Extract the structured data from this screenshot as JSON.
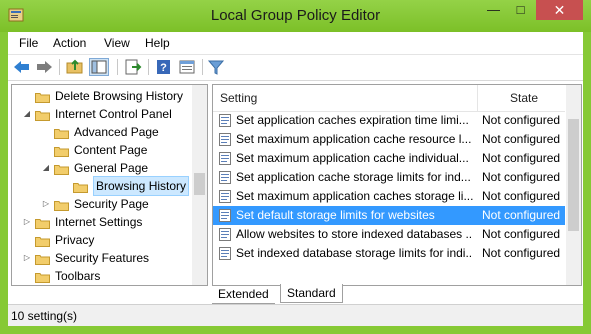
{
  "window": {
    "title": "Local Group Policy Editor"
  },
  "menu": [
    "File",
    "Action",
    "View",
    "Help"
  ],
  "toolbar": {
    "buttons": [
      "back-arrow-icon",
      "forward-arrow-icon",
      "up-folder-icon",
      "show-hide-tree-icon",
      "export-list-icon",
      "help-icon",
      "properties-icon",
      "filter-icon"
    ]
  },
  "tree": {
    "items": [
      {
        "label": "Delete Browsing History",
        "level": 1,
        "twist": ""
      },
      {
        "label": "Internet Control Panel",
        "level": 1,
        "twist": "open"
      },
      {
        "label": "Advanced Page",
        "level": 2,
        "twist": ""
      },
      {
        "label": "Content Page",
        "level": 2,
        "twist": ""
      },
      {
        "label": "General Page",
        "level": 2,
        "twist": "open"
      },
      {
        "label": "Browsing History",
        "level": 3,
        "twist": ""
      },
      {
        "label": "Security Page",
        "level": 2,
        "twist": "closed"
      },
      {
        "label": "Internet Settings",
        "level": 1,
        "twist": "closed"
      },
      {
        "label": "Privacy",
        "level": 1,
        "twist": ""
      },
      {
        "label": "Security Features",
        "level": 1,
        "twist": "closed"
      },
      {
        "label": "Toolbars",
        "level": 1,
        "twist": ""
      }
    ],
    "selected": "Browsing History"
  },
  "list": {
    "columns": {
      "setting": "Setting",
      "state": "State"
    },
    "rows": [
      {
        "setting": "Set application caches expiration time limi...",
        "state": "Not configured"
      },
      {
        "setting": "Set maximum application cache resource l...",
        "state": "Not configured"
      },
      {
        "setting": "Set maximum application cache individual...",
        "state": "Not configured"
      },
      {
        "setting": "Set application cache storage limits for ind...",
        "state": "Not configured"
      },
      {
        "setting": "Set maximum application caches storage li...",
        "state": "Not configured"
      },
      {
        "setting": "Set default storage limits for websites",
        "state": "Not configured"
      },
      {
        "setting": "Allow websites to store indexed databases ...",
        "state": "Not configured"
      },
      {
        "setting": "Set indexed database storage limits for indi...",
        "state": "Not configured"
      }
    ],
    "selected_index": 5
  },
  "tabs": [
    "Extended",
    "Standard"
  ],
  "active_tab": "Standard",
  "status": {
    "text": "10 setting(s)"
  },
  "colors": {
    "titlebar": "#8ecf3a",
    "selection": "#3399ff",
    "close": "#c75050"
  }
}
